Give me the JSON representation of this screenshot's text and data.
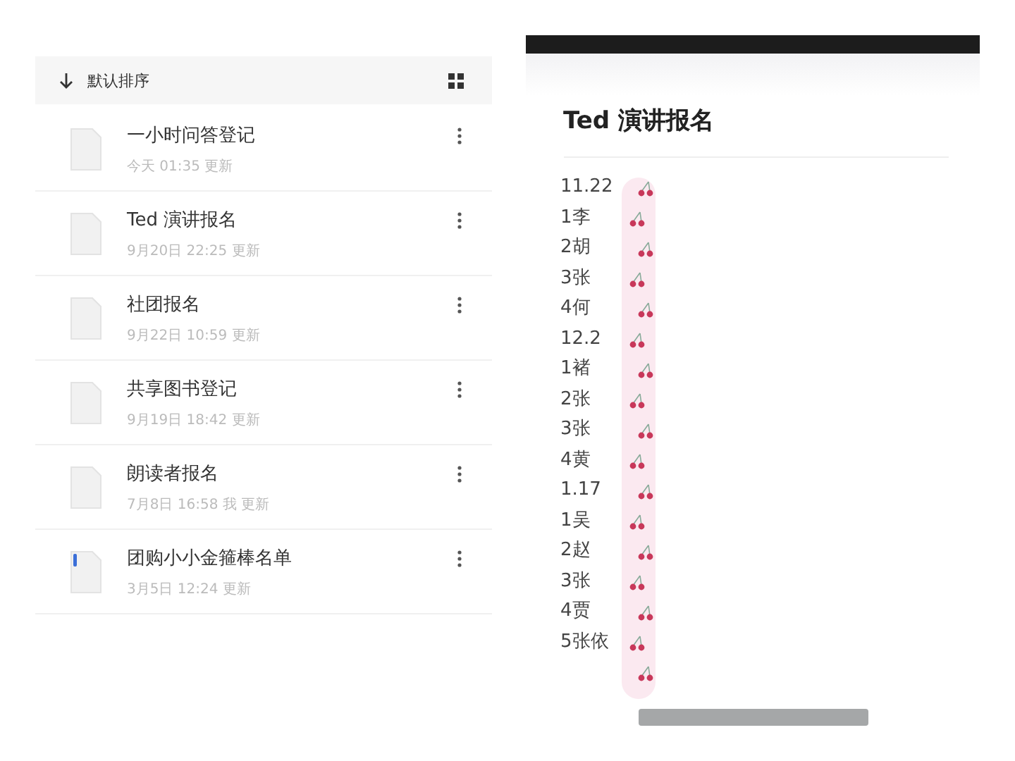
{
  "file_list": {
    "sort_label": "默认排序",
    "files": [
      {
        "title": "一小时问答登记",
        "updated": "今天 01:35  更新",
        "kind": "plain"
      },
      {
        "title": "Ted 演讲报名",
        "updated": "9月20日 22:25  更新",
        "kind": "plain"
      },
      {
        "title": "社团报名",
        "updated": "9月22日 10:59  更新",
        "kind": "plain"
      },
      {
        "title": "共享图书登记",
        "updated": "9月19日 18:42  更新",
        "kind": "plain"
      },
      {
        "title": "朗读者报名",
        "updated": "7月8日 16:58 我 更新",
        "kind": "plain"
      },
      {
        "title": "团购小小金箍棒名单",
        "updated": "3月5日 12:24  更新",
        "kind": "tagged"
      }
    ]
  },
  "document": {
    "title": "Ted 演讲报名",
    "lines": [
      "11.22",
      "1李",
      "2胡",
      "3张",
      "4何",
      "12.2",
      "1褚",
      "2张",
      "3张",
      "4黄",
      "1.17",
      "1吴",
      "2赵",
      "3张",
      "4贾",
      "5张依"
    ]
  }
}
